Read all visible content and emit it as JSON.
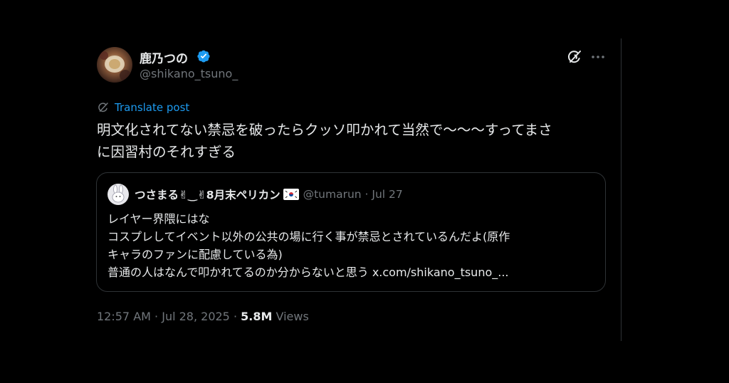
{
  "post": {
    "author": {
      "display_name": "鹿乃つの",
      "handle": "@shikano_tsuno_",
      "verified": true
    },
    "translate_label": "Translate post",
    "text_lines": [
      "明文化されてない禁忌を破ったらクッソ叩かれて当然で〜〜〜すってまさ",
      "に因習村のそれすぎる"
    ],
    "time": "12:57 AM",
    "separator": " · ",
    "date": "Jul 28, 2025",
    "views_count": "5.8M",
    "views_label": "Views"
  },
  "quote": {
    "display_name": "つさまる✌︎‿✌︎8月末ペリカン",
    "handle_date": "@tumarun · Jul 27",
    "lines": [
      "レイヤー界隈にはな",
      "コスプレしてイベント以外の公共の場に行く事が禁忌とされているんだよ(原作",
      "キャラのファンに配慮している為)",
      "普通の人はなんで叩かれてるのか分からないと思う "
    ],
    "link": "x.com/shikano_tsuno_..."
  },
  "icons": {
    "verified": "verified-badge-icon",
    "grok": "grok-icon",
    "more": "more-options-icon",
    "translate": "grok-translate-icon",
    "flag": "south-korea-flag-icon"
  },
  "colors": {
    "background": "#000000",
    "text_primary": "#e7e9ea",
    "text_secondary": "#71767b",
    "accent": "#1d9bf0",
    "border": "#2f3336"
  }
}
